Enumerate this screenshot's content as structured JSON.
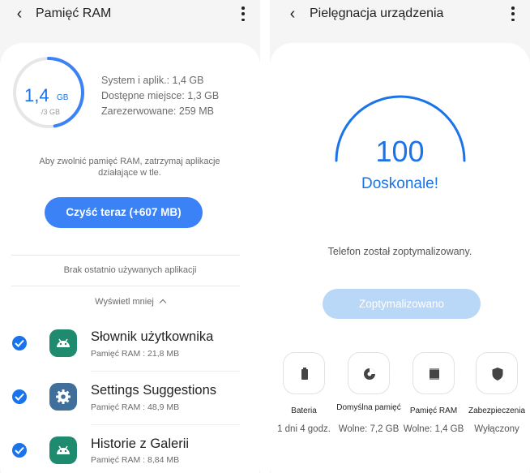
{
  "left": {
    "title": "Pamięć RAM",
    "ram_used": {
      "value": "1,4",
      "unit": "GB",
      "total": "/3 GB",
      "fraction": 0.47
    },
    "memory_info": [
      "System i aplik.: 1,4 GB",
      "Dostępne miejsce: 1,3 GB",
      "Zarezerwowane: 259 MB"
    ],
    "description": "Aby zwolnić pamięć RAM, zatrzymaj aplikacje działające w tle.",
    "clean_button": "Czyść teraz (+607 MB)",
    "no_recent": "Brak ostatnio używanych aplikacji",
    "show_less": "Wyświetl mniej",
    "apps": [
      {
        "name": "Słownik użytkownika",
        "memory": "Pamięć RAM : 21,8 MB",
        "icon": "android-icon",
        "icon_color": "#1e8a6e",
        "checked": true
      },
      {
        "name": "Settings Suggestions",
        "memory": "Pamięć RAM : 48,9 MB",
        "icon": "gear-icon",
        "icon_color": "#3f6f9a",
        "checked": true
      },
      {
        "name": "Historie z Galerii",
        "memory": "Pamięć RAM : 8,84 MB",
        "icon": "android-icon",
        "icon_color": "#1e8a6e",
        "checked": true
      }
    ]
  },
  "right": {
    "title": "Pielęgnacja urządzenia",
    "score": "100",
    "status": "Doskonale!",
    "message": "Telefon został zoptymalizowany.",
    "optimize_button": "Zoptymalizowano",
    "tiles": [
      {
        "name": "Bateria",
        "value": "1 dni 4 godz.",
        "icon": "battery-icon"
      },
      {
        "name": "Domyślna pamięć",
        "value": "Wolne: 7,2 GB",
        "icon": "storage-pie-icon"
      },
      {
        "name": "Pamięć RAM",
        "value": "Wolne: 1,4 GB",
        "icon": "ram-chip-icon"
      },
      {
        "name": "Zabezpieczenia",
        "value": "Wyłączony",
        "icon": "shield-icon"
      }
    ]
  },
  "colors": {
    "accent": "#1a73e8",
    "button": "#3b82f6",
    "button_disabled": "#b9d7f7",
    "check": "#1a73e8"
  }
}
